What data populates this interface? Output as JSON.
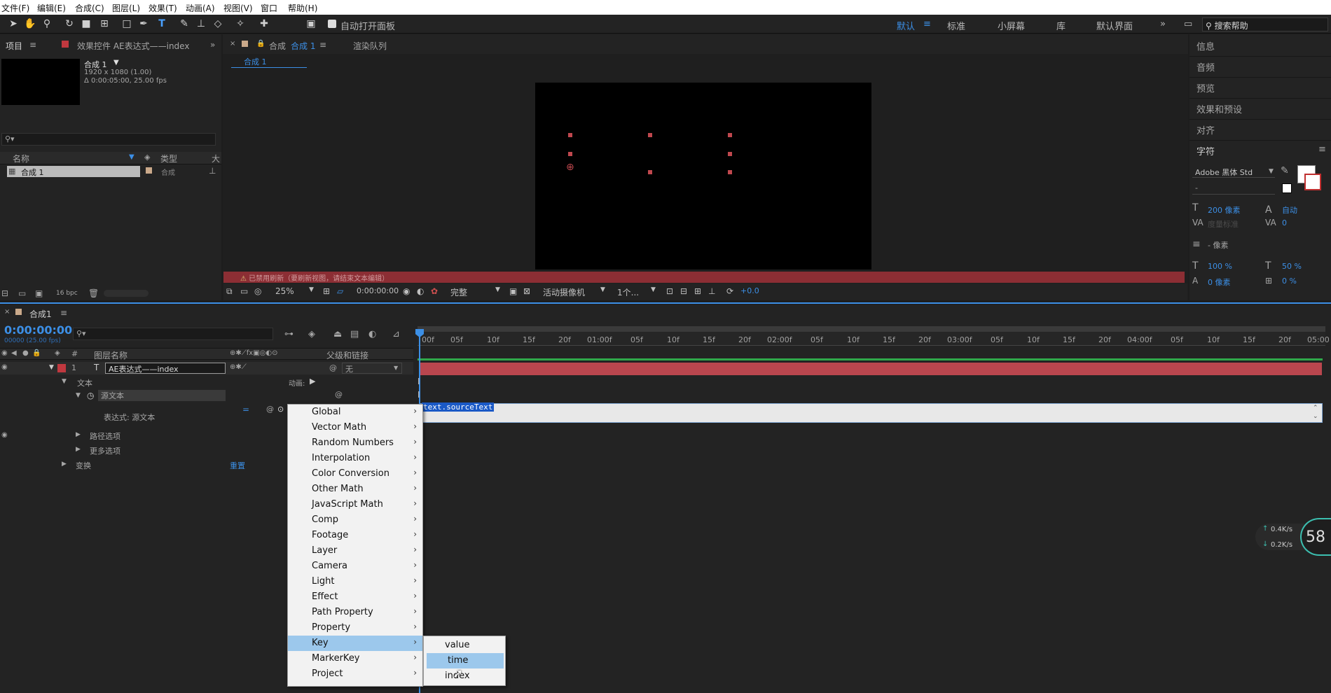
{
  "menubar": [
    "文件(F)",
    "编辑(E)",
    "合成(C)",
    "图层(L)",
    "效果(T)",
    "动画(A)",
    "视图(V)",
    "窗口",
    "帮助(H)"
  ],
  "toolbar": {
    "auto_open_panel": "自动打开面板",
    "workspaces": [
      "默认",
      "标准",
      "小屏幕",
      "库",
      "默认界面"
    ],
    "search_placeholder": "搜索帮助"
  },
  "project": {
    "tab_project": "项目",
    "tab_effects": "效果控件 AE表达式——index",
    "comp_name": "合成 1",
    "comp_res": "1920 x 1080 (1.00)",
    "comp_dur": "Δ 0:00:05:00, 25.00 fps",
    "col_name": "名称",
    "col_type": "类型",
    "col_size": "大",
    "item_name": "合成 1",
    "item_type": "合成",
    "bpc": "16 bpc"
  },
  "viewer": {
    "tab": "合成",
    "tab_comp": "合成 1",
    "tab_render": "渲染队列",
    "breadcrumb": "合成 1",
    "warning": "已禁用刷新（要刷新视图，请结束文本编辑）",
    "zoom": "25%",
    "time": "0:00:00:00",
    "quality": "完整",
    "camera": "活动摄像机",
    "views": "1个...",
    "offset": "+0.0"
  },
  "right": {
    "info": "信息",
    "audio": "音频",
    "preview": "预览",
    "effects": "效果和预设",
    "align": "对齐",
    "char": "字符",
    "font": "Adobe 黑体 Std",
    "style": "-",
    "size": "200 像素",
    "leading": "自动",
    "kern": "度量标准",
    "track": "0",
    "stroke": "- 像素",
    "vscale": "100 %",
    "hscale": "50 %",
    "baseline": "0 像素",
    "tsume": "0 %"
  },
  "timeline": {
    "tab": "合成1",
    "timecode": "0:00:00:00",
    "frames": "00000 (25.00 fps)",
    "col_layer": "图层名称",
    "col_parent": "父级和链接",
    "layer_num": "1",
    "layer_name": "AE表达式——index",
    "parent_val": "无",
    "text": "文本",
    "animate": "动画:",
    "source_text": "源文本",
    "expr_label": "表达式: 源文本",
    "path_opts": "路径选项",
    "more_opts": "更多选项",
    "transform": "变换",
    "reset": "重置",
    "expr_code": "text.sourceText",
    "ticks": [
      "00f",
      "05f",
      "10f",
      "15f",
      "20f",
      "01:00f",
      "05f",
      "10f",
      "15f",
      "20f",
      "02:00f",
      "05f",
      "10f",
      "15f",
      "20f",
      "03:00f",
      "05f",
      "10f",
      "15f",
      "20f",
      "04:00f",
      "05f",
      "10f",
      "15f",
      "20f",
      "05:00"
    ]
  },
  "menu": [
    "Global",
    "Vector Math",
    "Random Numbers",
    "Interpolation",
    "Color Conversion",
    "Other Math",
    "JavaScript Math",
    "Comp",
    "Footage",
    "Layer",
    "Camera",
    "Light",
    "Effect",
    "Path Property",
    "Property",
    "Key",
    "MarkerKey",
    "Project"
  ],
  "submenu": [
    "value",
    "time",
    "index"
  ],
  "net": {
    "up": "0.4K/s",
    "down": "0.2K/s",
    "pct": "58"
  }
}
